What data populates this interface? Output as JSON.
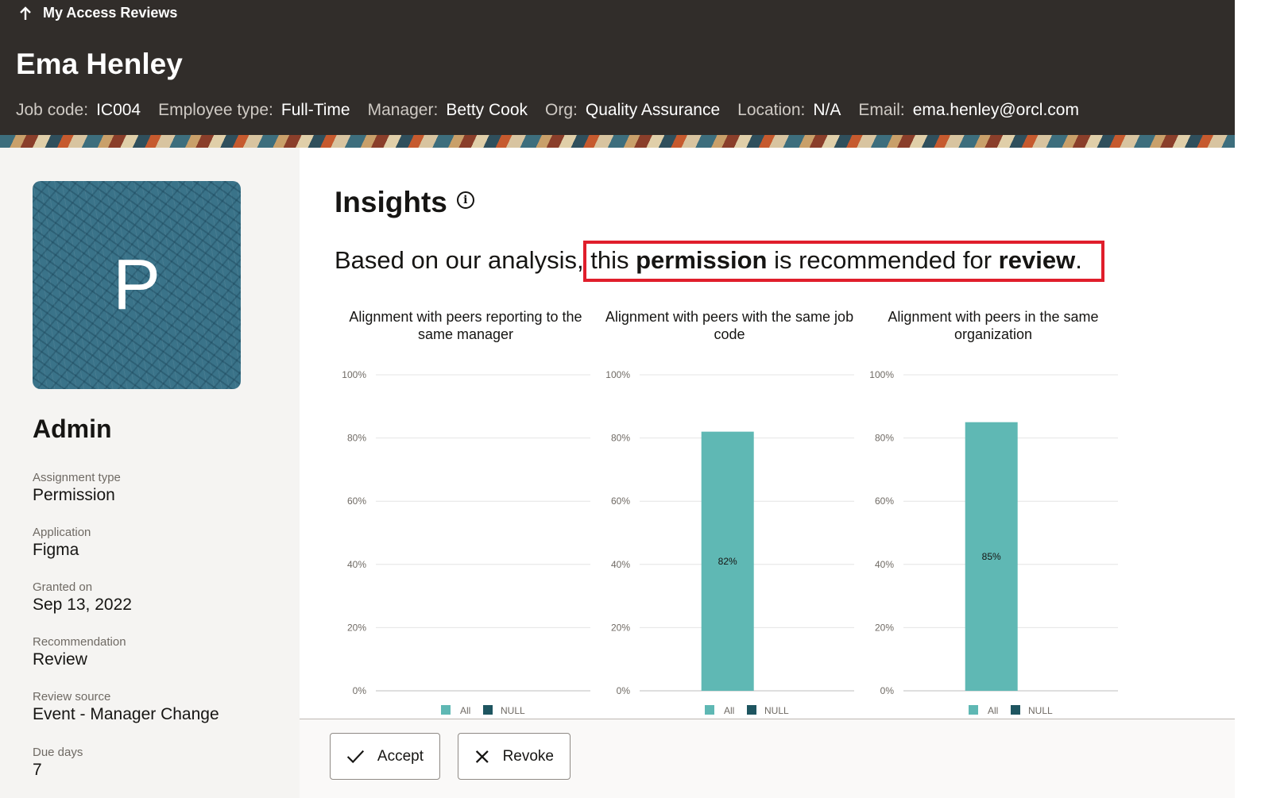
{
  "header": {
    "back_label": "My Access Reviews",
    "name": "Ema Henley",
    "meta": [
      {
        "label": "Job code:",
        "value": "IC004"
      },
      {
        "label": "Employee type:",
        "value": "Full-Time"
      },
      {
        "label": "Manager:",
        "value": "Betty Cook"
      },
      {
        "label": "Org:",
        "value": "Quality Assurance"
      },
      {
        "label": "Location:",
        "value": "N/A"
      },
      {
        "label": "Email:",
        "value": "ema.henley@orcl.com"
      }
    ]
  },
  "sidebar": {
    "avatar_letter": "P",
    "title": "Admin",
    "details": [
      {
        "label": "Assignment type",
        "value": "Permission"
      },
      {
        "label": "Application",
        "value": "Figma"
      },
      {
        "label": "Granted on",
        "value": "Sep 13, 2022"
      },
      {
        "label": "Recommendation",
        "value": "Review"
      },
      {
        "label": "Review source",
        "value": "Event - Manager Change"
      },
      {
        "label": "Due days",
        "value": "7"
      }
    ]
  },
  "insights": {
    "title": "Insights",
    "prefix": "Based on our analysis, ",
    "s1": "this ",
    "b1": "permission",
    "s2": " is recommended for ",
    "b2": "review",
    "s3": "."
  },
  "colors": {
    "all": "#5fb8b4",
    "null": "#1e5560",
    "highlight": "#e01e2b",
    "header_bg": "#312d2a"
  },
  "chart_data": [
    {
      "type": "bar",
      "title": "Alignment with peers reporting to the same manager",
      "categories": [
        ""
      ],
      "series": [
        {
          "name": "All",
          "values": [
            0
          ]
        },
        {
          "name": "NULL",
          "values": [
            0
          ]
        }
      ],
      "ylim": [
        0,
        100
      ],
      "yticks": [
        "0%",
        "20%",
        "40%",
        "60%",
        "80%",
        "100%"
      ],
      "legend": "bottom"
    },
    {
      "type": "bar",
      "title": "Alignment with peers with the same job code",
      "categories": [
        ""
      ],
      "series": [
        {
          "name": "All",
          "values": [
            82
          ]
        },
        {
          "name": "NULL",
          "values": [
            0
          ]
        }
      ],
      "data_labels": [
        "82%"
      ],
      "ylim": [
        0,
        100
      ],
      "yticks": [
        "0%",
        "20%",
        "40%",
        "60%",
        "80%",
        "100%"
      ],
      "legend": "bottom"
    },
    {
      "type": "bar",
      "title": "Alignment with peers in the same organization",
      "categories": [
        ""
      ],
      "series": [
        {
          "name": "All",
          "values": [
            85
          ]
        },
        {
          "name": "NULL",
          "values": [
            0
          ]
        }
      ],
      "data_labels": [
        "85%"
      ],
      "ylim": [
        0,
        100
      ],
      "yticks": [
        "0%",
        "20%",
        "40%",
        "60%",
        "80%",
        "100%"
      ],
      "legend": "bottom"
    }
  ],
  "actions": {
    "accept": "Accept",
    "revoke": "Revoke"
  }
}
